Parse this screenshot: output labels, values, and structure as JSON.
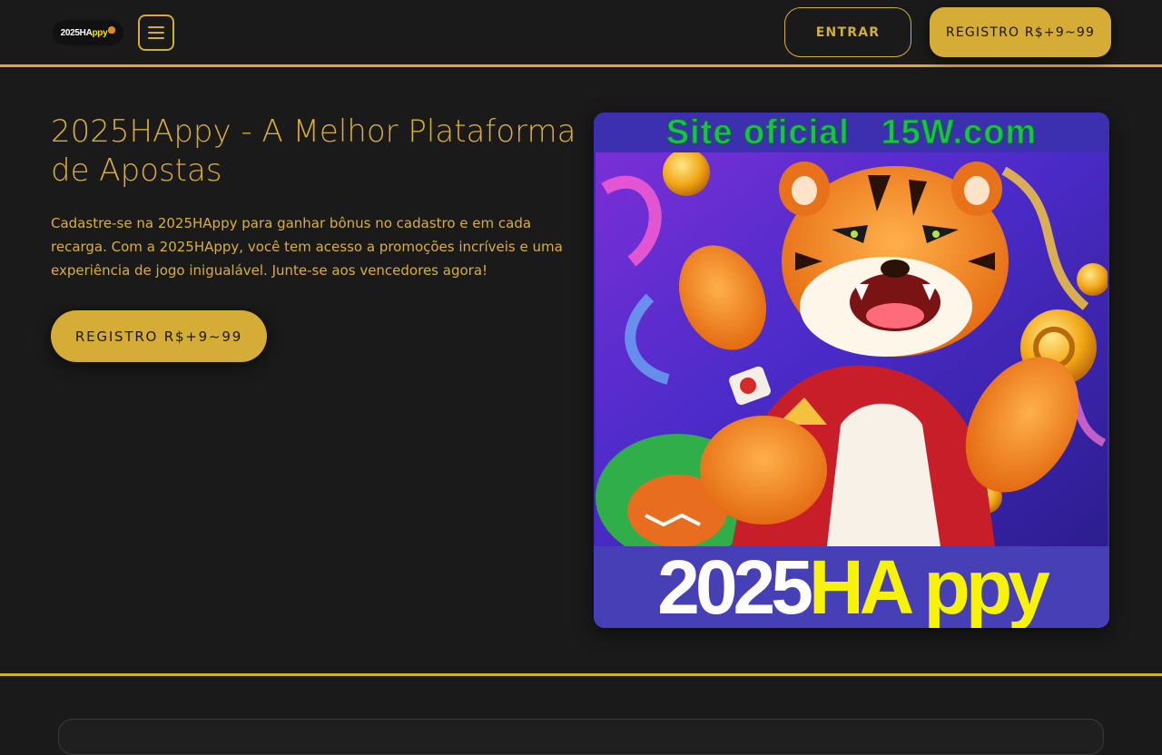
{
  "header": {
    "logo": {
      "part1": "2025",
      "part2": "HA",
      "part3": "ppy"
    },
    "menu_icon": "hamburger-menu-icon",
    "login_label": "ENTRAR",
    "register_label": "REGISTRO R$+9~99"
  },
  "hero": {
    "title": "2025HAppy - A Melhor Plataforma de Apostas",
    "description": "Cadastre-se na 2025HAppy para ganhar bônus no cadastro e em cada recarga. Com a 2025HAppy, você tem acesso a promoções incríveis e uma experiência de jogo inigualável. Junte-se aos vencedores agora!",
    "cta_label": "REGISTRO R$+9~99"
  },
  "banner": {
    "top_text": "Site oficial   15W.com",
    "bottom_white": "2025",
    "bottom_yellow": "HA ppy"
  },
  "colors": {
    "background": "#1a1a1a",
    "accent_gold": "#d4ac36",
    "banner_purple": "#3c2fb0",
    "banner_green_text": "#19c24a",
    "banner_yellow_text": "#f6f20a"
  }
}
